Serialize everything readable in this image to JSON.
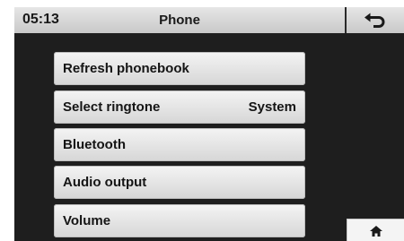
{
  "header": {
    "time": "05:13",
    "title": "Phone",
    "back_icon": "back-arrow-icon"
  },
  "menu": {
    "items": [
      {
        "label": "Refresh phonebook",
        "value": ""
      },
      {
        "label": "Select ringtone",
        "value": "System"
      },
      {
        "label": "Bluetooth",
        "value": ""
      },
      {
        "label": "Audio output",
        "value": ""
      },
      {
        "label": "Volume",
        "value": ""
      }
    ]
  },
  "home": {
    "icon": "home-icon"
  },
  "colors": {
    "screen_background": "#1e1e1e",
    "header_background": "#d6d6d6",
    "button_background": "#e6e6e6",
    "text": "#151515"
  }
}
